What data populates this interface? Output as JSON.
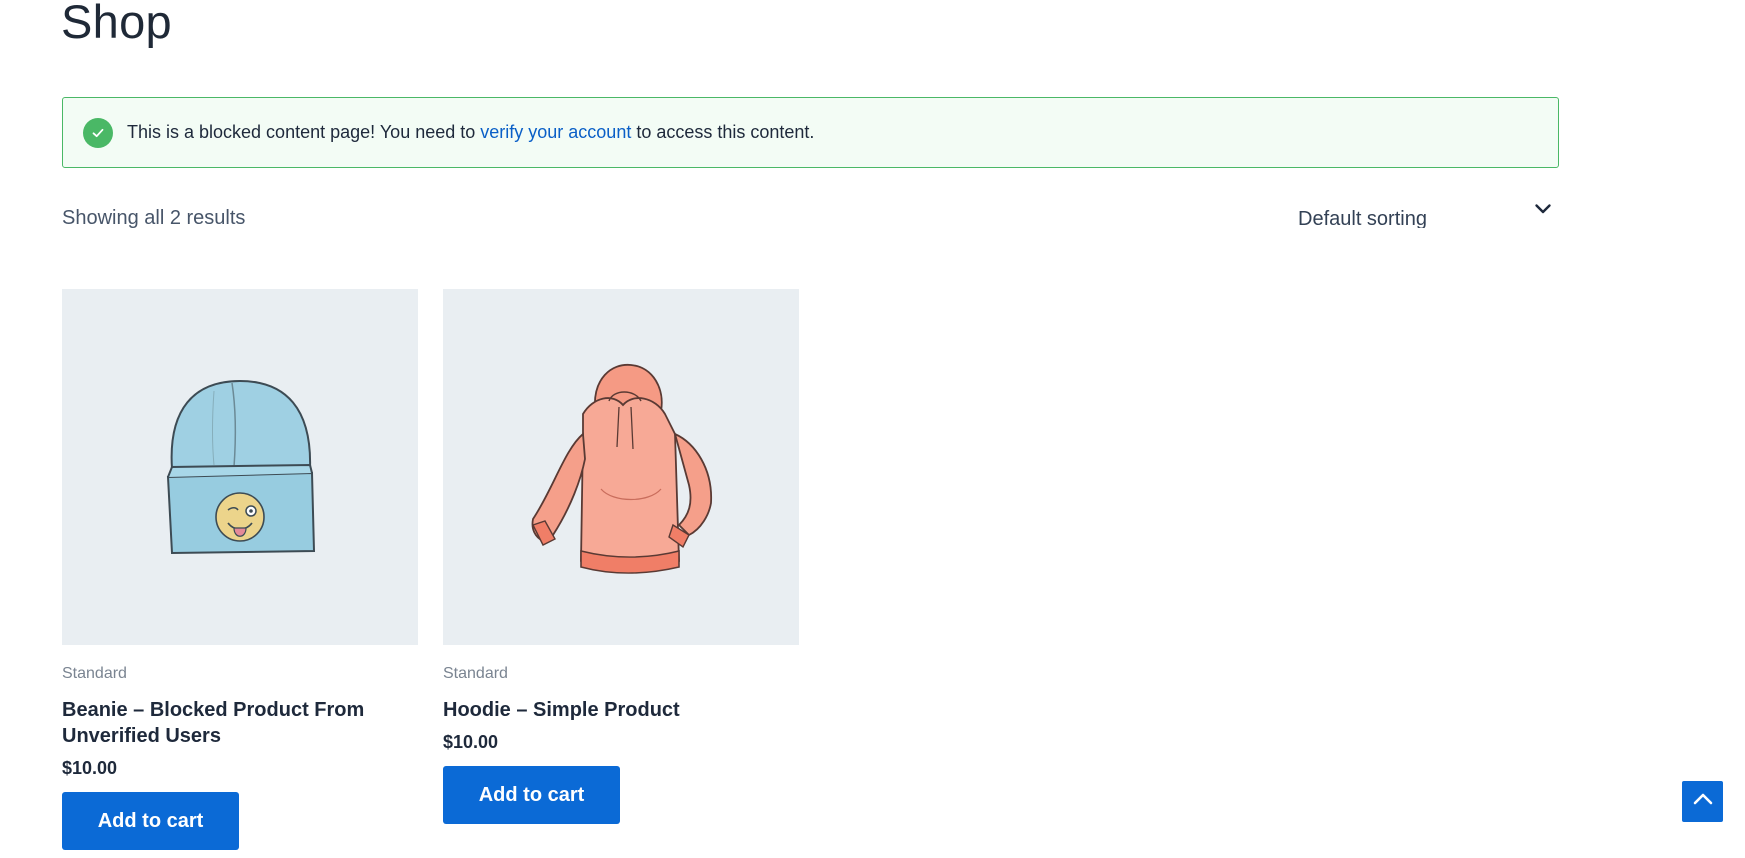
{
  "page": {
    "title": "Shop"
  },
  "notice": {
    "text_before": "This is a blocked content page! You need to ",
    "link_text": "verify your account",
    "text_after": " to access this content.",
    "icon": "check-circle-icon",
    "color": "#4ab866"
  },
  "toolbar": {
    "result_count": "Showing all 2 results",
    "sort_selected": "Default sorting",
    "sort_icon": "chevron-down-icon"
  },
  "products": [
    {
      "category": "Standard",
      "title": "Beanie – Blocked Product From Unverified Users",
      "price": "$10.00",
      "button_label": "Add to cart",
      "image": "beanie-image"
    },
    {
      "category": "Standard",
      "title": "Hoodie – Simple Product",
      "price": "$10.00",
      "button_label": "Add to cart",
      "image": "hoodie-image"
    }
  ],
  "scroll_top": {
    "icon": "chevron-up-icon"
  },
  "colors": {
    "accent": "#0b6ad6",
    "success": "#4ab866",
    "link": "#0a5fc7"
  }
}
